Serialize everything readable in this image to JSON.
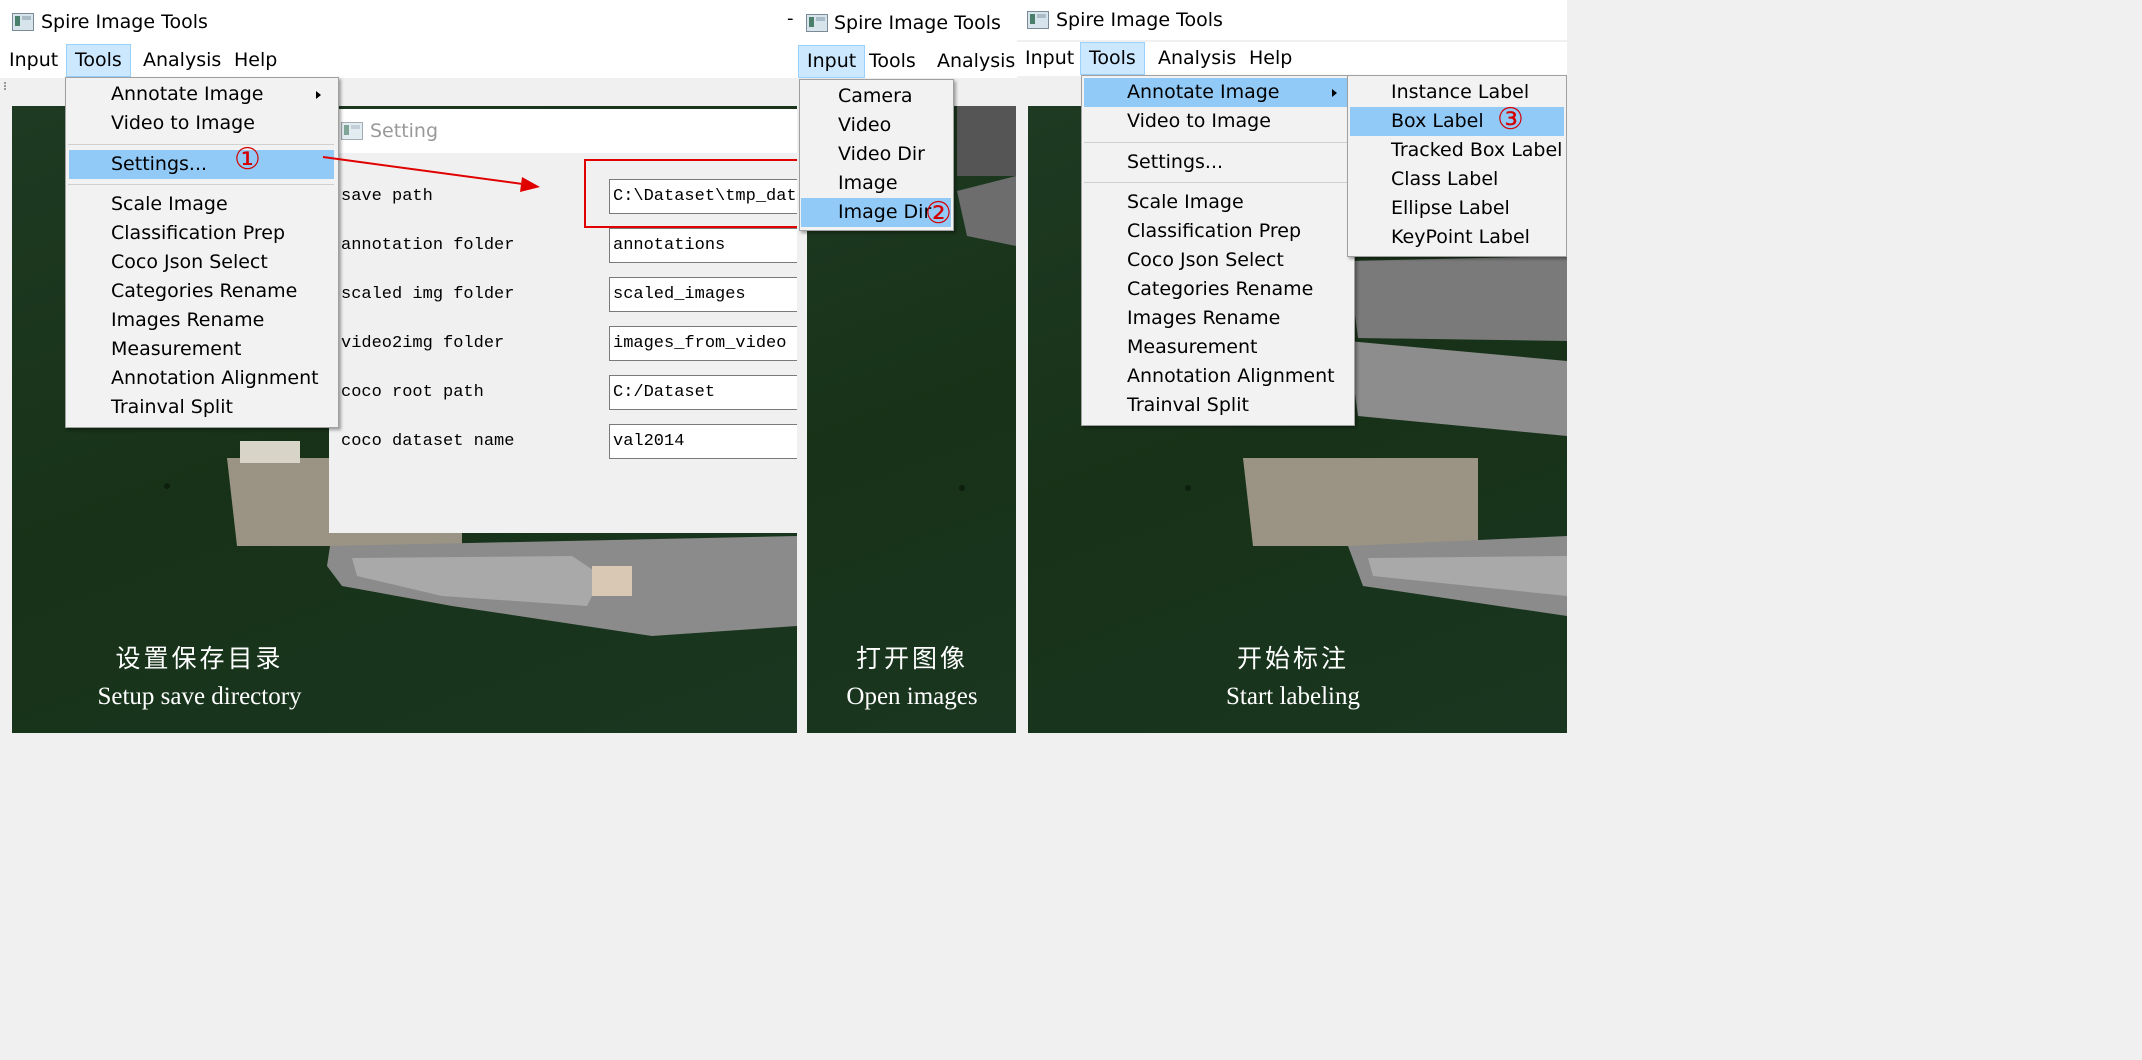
{
  "panels": [
    {
      "title": "Spire Image Tools",
      "menubar": [
        "Input",
        "Tools",
        "Analysis",
        "Help"
      ],
      "caption_cn": "设置保存目录",
      "caption_en": "Setup save directory"
    },
    {
      "title": "Spire Image Tools",
      "menubar": [
        "Input",
        "Tools",
        "Analysis"
      ],
      "caption_cn": "打开图像",
      "caption_en": "Open images"
    },
    {
      "title": "Spire Image Tools",
      "menubar": [
        "Input",
        "Tools",
        "Analysis",
        "Help"
      ],
      "caption_cn": "开始标注",
      "caption_en": "Start labeling"
    }
  ],
  "tools_menu": {
    "items": [
      "Annotate Image",
      "Video to Image",
      "Settings...",
      "Scale Image",
      "Classification Prep",
      "Coco Json Select",
      "Categories Rename",
      "Images Rename",
      "Measurement",
      "Annotation Alignment",
      "Trainval Split"
    ]
  },
  "input_menu": {
    "items": [
      "Camera",
      "Video",
      "Video Dir",
      "Image",
      "Image Dir"
    ]
  },
  "annotate_submenu": {
    "items": [
      "Instance Label",
      "Box Label",
      "Tracked Box Label",
      "Class Label",
      "Ellipse Label",
      "KeyPoint Label"
    ]
  },
  "settings_dialog": {
    "title": "Setting",
    "rows": [
      {
        "label": "save path",
        "value": "C:\\Dataset\\tmp_data"
      },
      {
        "label": "annotation folder",
        "value": "annotations"
      },
      {
        "label": "scaled img folder",
        "value": "scaled_images"
      },
      {
        "label": "video2img folder",
        "value": "images_from_video"
      },
      {
        "label": "coco root path",
        "value": "C:/Dataset"
      },
      {
        "label": "coco dataset name",
        "value": "val2014"
      }
    ]
  },
  "step_markers": [
    "①",
    "②",
    "③"
  ],
  "stray_mark": "-",
  "colors": {
    "menu_highlight": "#91c9f7",
    "menubar_active": "#cce8ff",
    "annotation_red": "#e00000",
    "ship_deck": "#8a8a8a",
    "water": "#183418"
  }
}
